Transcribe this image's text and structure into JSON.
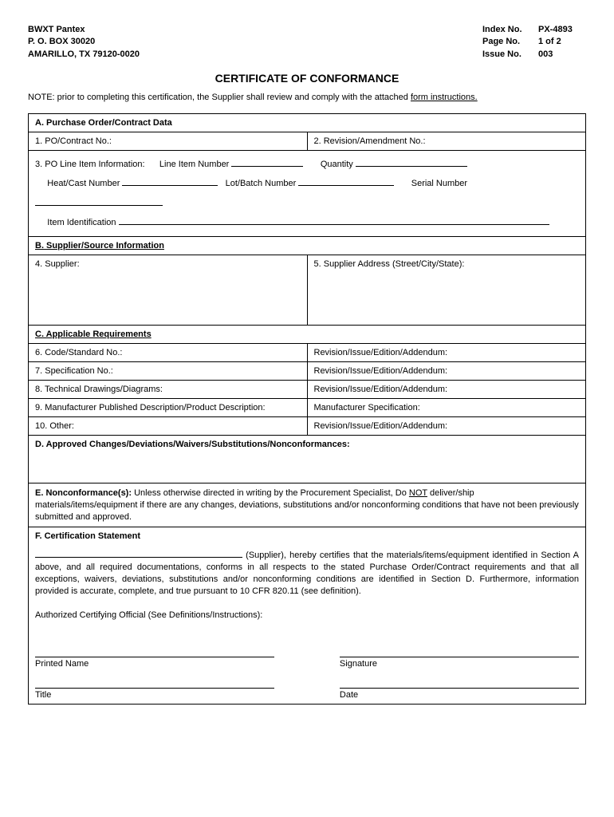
{
  "header": {
    "company": "BWXT Pantex",
    "pobox": "P. O. BOX 30020",
    "citystate": "AMARILLO, TX 79120-0020",
    "index_label": "Index No.",
    "index_value": "PX-4893",
    "page_label": "Page No.",
    "page_value": "1 of 2",
    "issue_label": "Issue No.",
    "issue_value": "003"
  },
  "title": "CERTIFICATE OF CONFORMANCE",
  "note_prefix": "NOTE:  prior to completing this certification, the Supplier shall review and comply with the attached ",
  "note_link": "form instructions.",
  "sectionA": {
    "header": "A.   Purchase Order/Contract Data",
    "row1_left": "1.  PO/Contract No.:",
    "row1_right": "2.  Revision/Amendment No.:",
    "line3_prefix": "3.  PO Line Item Information:",
    "line_item_number": "Line Item Number",
    "quantity": "Quantity",
    "heat_cast": "Heat/Cast Number",
    "lot_batch": "Lot/Batch Number",
    "serial": "Serial Number",
    "item_id": "Item Identification"
  },
  "sectionB": {
    "header": "B.    Supplier/Source Information",
    "supplier": "4.    Supplier:",
    "address": "5.  Supplier Address (Street/City/State):"
  },
  "sectionC": {
    "header": "C.   Applicable Requirements",
    "r6l": "6.  Code/Standard No.:",
    "r6r": "Revision/Issue/Edition/Addendum:",
    "r7l": "7.  Specification No.:",
    "r7r": "Revision/Issue/Edition/Addendum:",
    "r8l": "8.  Technical Drawings/Diagrams:",
    "r8r": "Revision/Issue/Edition/Addendum:",
    "r9l": "9.  Manufacturer Published Description/Product Description:",
    "r9r": "Manufacturer Specification:",
    "r10l": "10.  Other:",
    "r10r": "Revision/Issue/Edition/Addendum:"
  },
  "sectionD": {
    "header": "D.  Approved Changes/Deviations/Waivers/Substitutions/Nonconformances:"
  },
  "sectionE": {
    "label": "E.  Nonconformance(s):",
    "text1": " Unless otherwise directed in writing by the Procurement Specialist, Do ",
    "not": "NOT",
    "text2": " deliver/ship materials/items/equipment if there are any changes, deviations, substitutions and/or nonconforming conditions that have not been previously submitted and approved."
  },
  "sectionF": {
    "header": "F.  Certification Statement",
    "cert_text": " (Supplier), hereby certifies that the materials/items/equipment identified in Section A above, and all required documentations, conforms in all respects to the stated Purchase Order/Contract requirements and that all exceptions, waivers, deviations, substitutions and/or nonconforming conditions are identified in Section D.  Furthermore, information provided is accurate, complete, and true pursuant to 10 CFR 820.11 (see definition).",
    "authorized": "Authorized Certifying Official (See Definitions/Instructions):",
    "printed_name": "Printed Name",
    "signature": "Signature",
    "title_label": "Title",
    "date_label": "Date"
  }
}
